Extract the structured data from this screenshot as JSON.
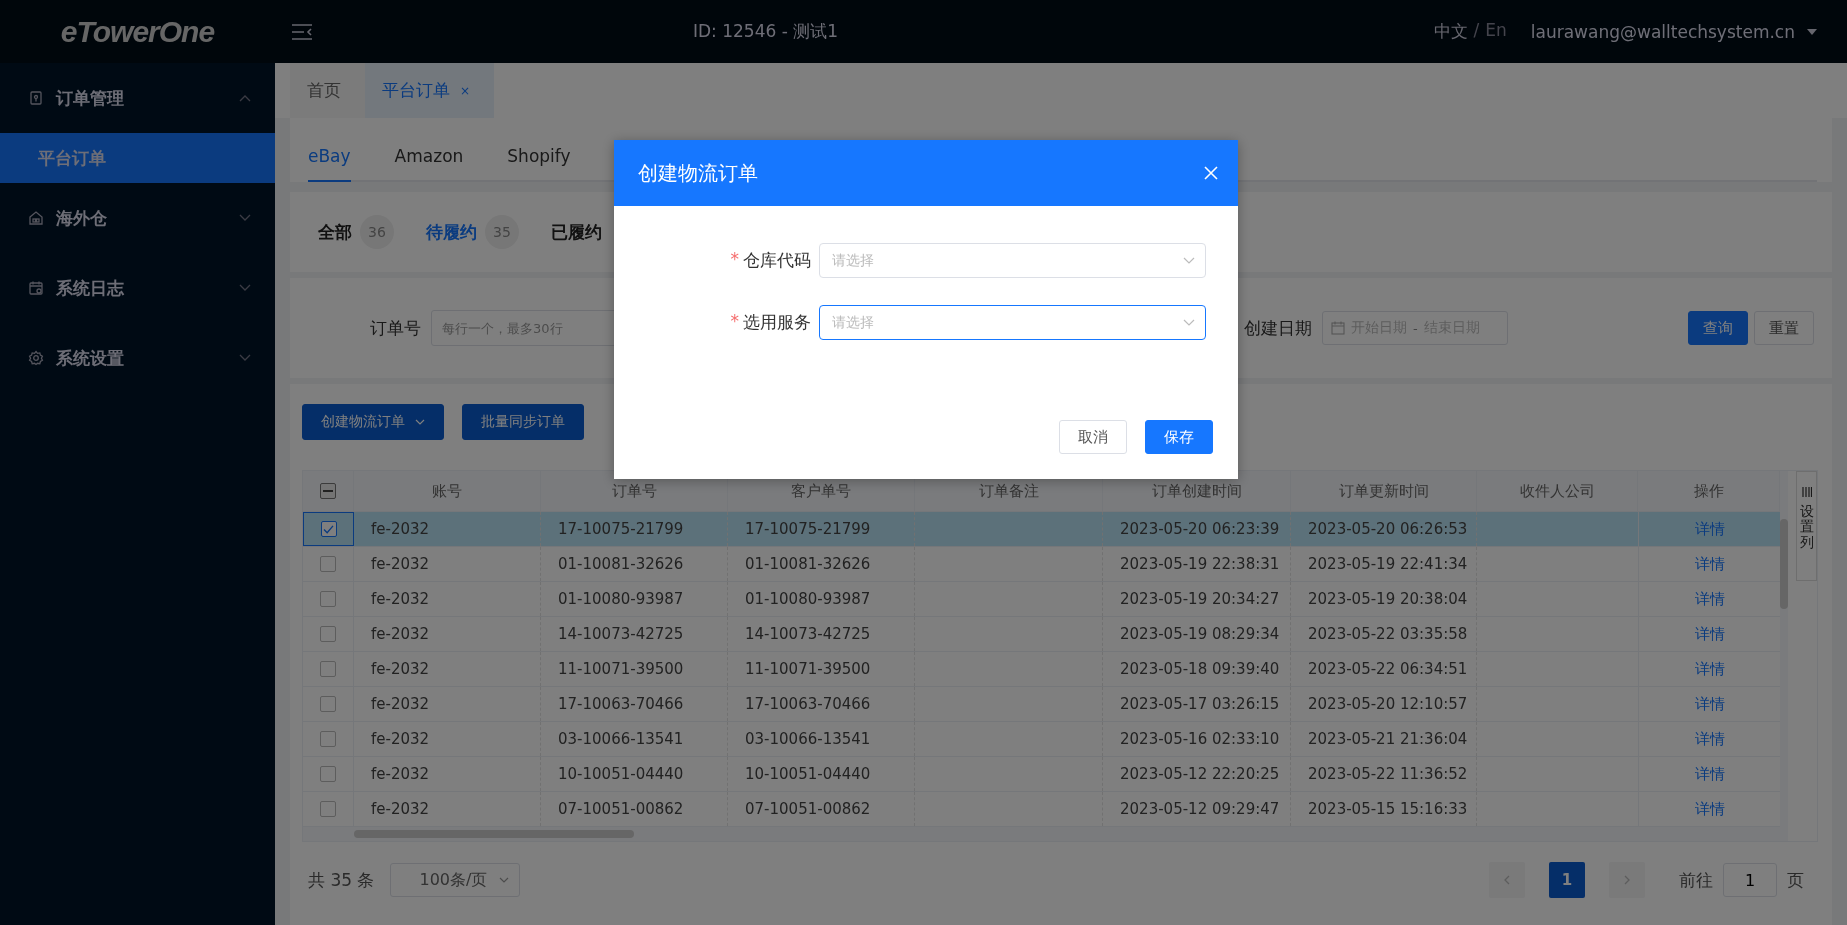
{
  "header": {
    "logo": "eTowerOne",
    "title": "ID: 12546 - 测试1",
    "languages": [
      {
        "label": "中文",
        "selected": true
      },
      {
        "label": "En",
        "selected": false
      }
    ],
    "language_separator": "/",
    "user": "laurawang@walltechsystem.cn"
  },
  "sidebar": {
    "items": [
      {
        "label": "订单管理",
        "expanded": true,
        "children": [
          {
            "label": "平台订单",
            "selected": true
          }
        ]
      },
      {
        "label": "海外仓",
        "expanded": false
      },
      {
        "label": "系统日志",
        "expanded": false
      },
      {
        "label": "系统设置",
        "expanded": false
      }
    ]
  },
  "page_tabs": [
    {
      "label": "首页",
      "selected": false
    },
    {
      "label": "平台订单",
      "selected": true,
      "close": "×"
    }
  ],
  "platform_tabs": [
    {
      "label": "eBay",
      "selected": true
    },
    {
      "label": "Amazon",
      "selected": false
    },
    {
      "label": "Shopify",
      "selected": false
    }
  ],
  "status_filters": [
    {
      "label": "全部",
      "count": "36",
      "selected": false
    },
    {
      "label": "待履约",
      "count": "35",
      "selected": true
    },
    {
      "label": "已履约",
      "selected": false
    }
  ],
  "filters": {
    "order_no": {
      "label": "订单号",
      "placeholder": "每行一个，最多30行"
    },
    "created_date": {
      "label": "创建日期",
      "start_placeholder": "开始日期",
      "separator": "-",
      "end_placeholder": "结束日期"
    },
    "buttons": [
      {
        "label": "查询",
        "kind": "primary"
      },
      {
        "label": "重置",
        "kind": "default"
      }
    ]
  },
  "toolbar": [
    {
      "label": "创建物流订单",
      "dropdown": true
    },
    {
      "label": "批量同步订单",
      "dropdown": false
    }
  ],
  "table": {
    "select_all_indeterminate": true,
    "columns": [
      "账号",
      "订单号",
      "客户单号",
      "订单备注",
      "订单创建时间",
      "订单更新时间",
      "收件人公司",
      "操作"
    ],
    "rows": [
      {
        "checked": true,
        "account": "fe-2032",
        "order_no": "17-10075-21799",
        "customer_no": "17-10075-21799",
        "created": "2023-05-20 06:23:39",
        "updated": "2023-05-20 06:26:53",
        "action": "详情"
      },
      {
        "checked": false,
        "account": "fe-2032",
        "order_no": "01-10081-32626",
        "customer_no": "01-10081-32626",
        "created": "2023-05-19 22:38:31",
        "updated": "2023-05-19 22:41:34",
        "action": "详情"
      },
      {
        "checked": false,
        "account": "fe-2032",
        "order_no": "01-10080-93987",
        "customer_no": "01-10080-93987",
        "created": "2023-05-19 20:34:27",
        "updated": "2023-05-19 20:38:04",
        "action": "详情"
      },
      {
        "checked": false,
        "account": "fe-2032",
        "order_no": "14-10073-42725",
        "customer_no": "14-10073-42725",
        "created": "2023-05-19 08:29:34",
        "updated": "2023-05-22 03:35:58",
        "action": "详情"
      },
      {
        "checked": false,
        "account": "fe-2032",
        "order_no": "11-10071-39500",
        "customer_no": "11-10071-39500",
        "created": "2023-05-18 09:39:40",
        "updated": "2023-05-22 06:34:51",
        "action": "详情"
      },
      {
        "checked": false,
        "account": "fe-2032",
        "order_no": "17-10063-70466",
        "customer_no": "17-10063-70466",
        "created": "2023-05-17 03:26:15",
        "updated": "2023-05-20 12:10:57",
        "action": "详情"
      },
      {
        "checked": false,
        "account": "fe-2032",
        "order_no": "03-10066-13541",
        "customer_no": "03-10066-13541",
        "created": "2023-05-16 02:33:10",
        "updated": "2023-05-21 21:36:04",
        "action": "详情"
      },
      {
        "checked": false,
        "account": "fe-2032",
        "order_no": "10-10051-04440",
        "customer_no": "10-10051-04440",
        "created": "2023-05-12 22:20:25",
        "updated": "2023-05-22 11:36:52",
        "action": "详情"
      },
      {
        "checked": false,
        "account": "fe-2032",
        "order_no": "07-10051-00862",
        "customer_no": "07-10051-00862",
        "created": "2023-05-12 09:29:47",
        "updated": "2023-05-15 15:16:33",
        "action": "详情"
      }
    ],
    "column_settings": "设置列"
  },
  "pagination": {
    "total": "共 35 条",
    "page_size": "100条/页",
    "pages": [
      {
        "label": "1",
        "selected": true
      }
    ],
    "goto_label": "前往",
    "goto_value": "1",
    "goto_suffix": "页"
  },
  "dialog": {
    "title": "创建物流订单",
    "fields": [
      {
        "label": "仓库代码",
        "required_mark": "*",
        "placeholder": "请选择",
        "focused": false
      },
      {
        "label": "选用服务",
        "required_mark": "*",
        "placeholder": "请选择",
        "focused": true
      }
    ],
    "buttons": [
      {
        "label": "取消",
        "kind": "default"
      },
      {
        "label": "保存",
        "kind": "primary"
      }
    ]
  }
}
